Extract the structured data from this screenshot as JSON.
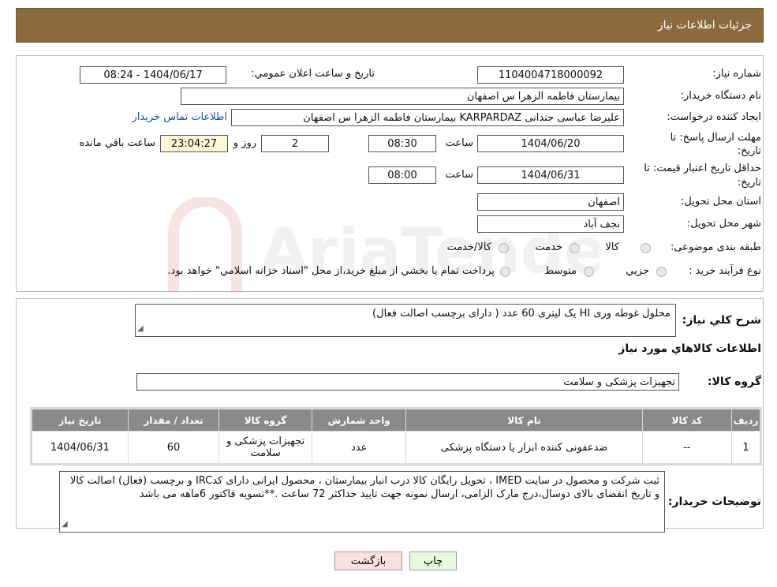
{
  "page_title": "جزئیات اطلاعات نیاز",
  "fields": {
    "need_number": {
      "label": "شماره نیاز:",
      "value": "1104004718000092"
    },
    "announce_datetime": {
      "label": "تاریخ و ساعت اعلان عمومي:",
      "value": "1404/06/17 - 08:24"
    },
    "buyer_org": {
      "label": "نام دستگاه خريدار:",
      "value": "بیمارستان فاطمه الزهرا س  اصفهان"
    },
    "requester": {
      "label": "ایجاد کننده درخواست:",
      "value": "علیرضا عباسی جندانی KARPARDAZ بیمارستان فاطمه الزهرا س  اصفهان",
      "contact_link": "اطلاعات تماس خريدار"
    },
    "reply_deadline": {
      "label_line1": "مهلت ارسال پاسخ: تا",
      "label_line2": "تاريخ:",
      "date": "1404/06/20",
      "time_label": "ساعت",
      "time": "08:30",
      "days": "2",
      "days_label": "روز و",
      "remaining": "23:04:27",
      "remaining_label": "ساعت باقي مانده"
    },
    "price_validity": {
      "label_line1": "حداقل تاريخ اعتبار قيمت: تا",
      "label_line2": "تاريخ:",
      "date": "1404/06/31",
      "time_label": "ساعت",
      "time": "08:00"
    },
    "delivery_province": {
      "label": "استان محل تحويل:",
      "value": "اصفهان"
    },
    "delivery_city": {
      "label": "شهر محل تحويل:",
      "value": "نجف آباد"
    },
    "category": {
      "label": "طبقه بندی موضوعی:",
      "options": [
        "کالا",
        "خدمت",
        "کالا/خدمت"
      ]
    },
    "purchase_type": {
      "label": "نوع فرآيند خريد :",
      "options": [
        "جزيي",
        "متوسط"
      ],
      "note": "پرداخت تمام يا بخشي از مبلغ خريد،از محل \"اسناد خزانه اسلامي\" خواهد بود."
    }
  },
  "summary": {
    "label": "شرح کلي نياز:",
    "value": "محلول غوطه وری HI  یک لیتری        60 عدد ( دارای برچسب اصالت فعال)"
  },
  "goods_section_title": "اطلاعات کالاهاي مورد نياز",
  "goods_group": {
    "label": "گروه کالا:",
    "value": "تجهیزات پزشکی و سلامت"
  },
  "table": {
    "headers": [
      "رديف",
      "کد کالا",
      "نام کالا",
      "واحد شمارش",
      "گروه کالا",
      "تعداد / مقدار",
      "تاريخ نياز"
    ],
    "rows": [
      [
        "1",
        "--",
        "ضدعفونی کننده ابزار یا دستگاه پزشکی",
        "عدد",
        "تجهیزات پزشکی و سلامت",
        "60",
        "1404/06/31"
      ]
    ]
  },
  "buyer_notes": {
    "label": "توضيحات خريدار:",
    "value": "ثبت شرکت و محصول در سایت IMED ، تحویل رایگان کالا درب انبار بیمارستان ، محصول ایرانی دارای کدIRC و برچسب (فعال) اصالت کالا و تاریخ انقضای بالای دوسال،درج مارک الزامی،  ارسال نمونه جهت تایید حداکثر 72 ساعت .**تسویه فاکتور 6ماهه می باشد"
  },
  "buttons": {
    "print": "چاپ",
    "back": "بازگشت"
  },
  "watermark": "AriaTender.neT",
  "colors": {
    "header_bg": "#8b6a3d",
    "table_header_bg": "#8a8a8a",
    "print_btn_bg": "#e7f8dd",
    "back_btn_bg": "#fbe0e0",
    "watermark": "#c0392b"
  }
}
